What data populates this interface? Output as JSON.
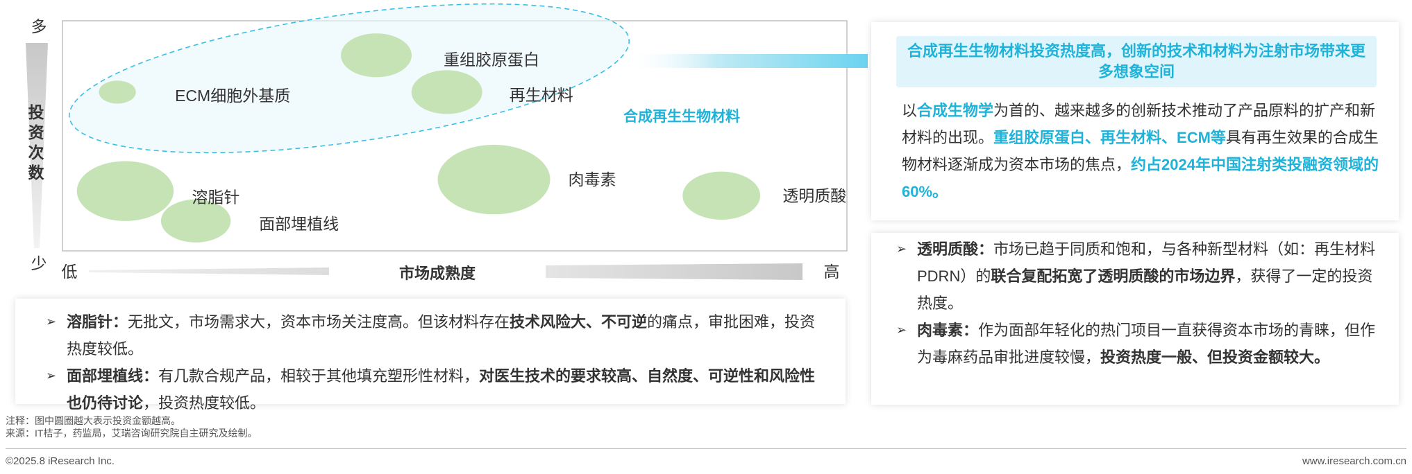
{
  "chart_data": {
    "type": "scatter",
    "title": "",
    "xlabel": "市场成熟度",
    "ylabel": "投资次数",
    "x_low": "低",
    "x_high": "高",
    "y_high": "多",
    "y_low": "少",
    "xlim": [
      0,
      100
    ],
    "ylim": [
      0,
      100
    ],
    "grid": false,
    "legend": "none",
    "points": [
      {
        "label": "重组胶原蛋白",
        "x": 40,
        "y": 85,
        "size": 0.63
      },
      {
        "label": "ECM细胞外基质",
        "x": 7,
        "y": 69,
        "size": 0.33
      },
      {
        "label": "再生材料",
        "x": 49,
        "y": 69,
        "size": 0.63
      },
      {
        "label": "溶脂针",
        "x": 8,
        "y": 26,
        "size": 0.86
      },
      {
        "label": "面部埋植线",
        "x": 17,
        "y": 13,
        "size": 0.62
      },
      {
        "label": "肉毒素",
        "x": 55,
        "y": 31,
        "size": 1.0
      },
      {
        "label": "透明质酸",
        "x": 84,
        "y": 24,
        "size": 0.69
      }
    ],
    "group_label": "合成再生生物材料"
  },
  "colors": {
    "bubble": "#c5e3b5",
    "accent": "#1fb3d9",
    "text": "#333333"
  },
  "left_notes": [
    {
      "title": "溶脂针：",
      "segments": [
        {
          "t": "无批文，市场需求大，资本市场关注度高。但该材料存在",
          "b": false
        },
        {
          "t": "技术风险大、不可逆",
          "b": true
        },
        {
          "t": "的痛点，审批困难，投资热度较低。",
          "b": false
        }
      ]
    },
    {
      "title": "面部埋植线：",
      "segments": [
        {
          "t": "有几款合规产品，相较于其他填充塑形性材料，",
          "b": false
        },
        {
          "t": "对医生技术的要求较高、自然度、可逆性和风险性也仍待讨论",
          "b": true
        },
        {
          "t": "，投资热度较低。",
          "b": false
        }
      ]
    }
  ],
  "headline": "合成再生生物材料投资热度高，创新的技术和材料为注射市场带来更多想象空间",
  "summary_segments": [
    {
      "t": "以",
      "s": "n"
    },
    {
      "t": "合成生物学",
      "s": "h"
    },
    {
      "t": "为首的、越来越多的创新技术推动了产品原料的扩产和新材料的出现。",
      "s": "n"
    },
    {
      "t": "重组胶原蛋白、再生材料、ECM等",
      "s": "h"
    },
    {
      "t": "具有再生效果的合成生物材料逐渐成为资本市场的焦点，",
      "s": "n"
    },
    {
      "t": "约占2024年中国注射类投融资领域的60%。",
      "s": "h"
    }
  ],
  "right_notes": [
    {
      "title": "透明质酸：",
      "segments": [
        {
          "t": "市场已趋于同质和饱和，与各种新型材料（如：再生材料PDRN）的",
          "b": false
        },
        {
          "t": "联合复配拓宽了透明质酸的市场边界",
          "b": true
        },
        {
          "t": "，获得了一定的投资热度。",
          "b": false
        }
      ]
    },
    {
      "title": "肉毒素：",
      "segments": [
        {
          "t": "作为面部年轻化的热门项目一直获得资本市场的青睐，但作为毒麻药品审批进度较慢，",
          "b": false
        },
        {
          "t": "投资热度一般、但投资金额较大。",
          "b": true
        }
      ]
    }
  ],
  "footnote_note": "注释：图中圆圈越大表示投资金额越高。",
  "footnote_source": "来源：IT桔子，药监局，艾瑞咨询研究院自主研究及绘制。",
  "footer_left": "©2025.8 iResearch Inc.",
  "footer_right": "www.iresearch.com.cn"
}
